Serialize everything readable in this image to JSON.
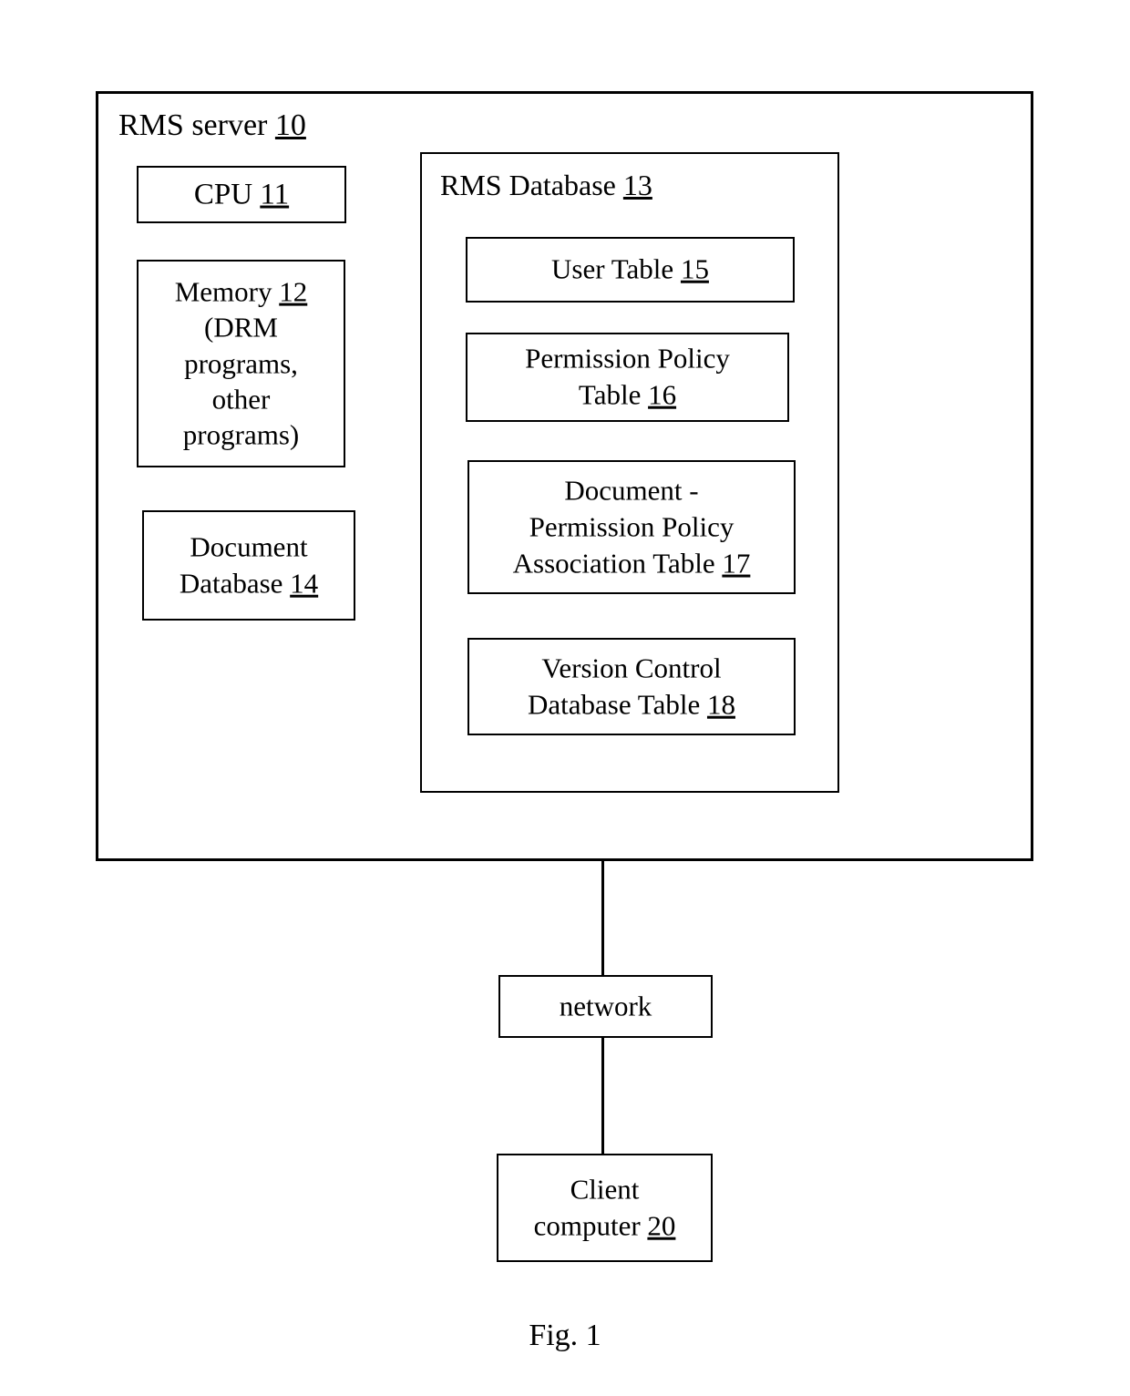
{
  "figure": {
    "caption": "Fig. 1"
  },
  "server": {
    "title_text": "RMS server ",
    "title_ref": "10",
    "cpu": {
      "text": "CPU ",
      "ref": "11"
    },
    "memory": {
      "text": "Memory ",
      "ref": "12",
      "detail": "\n(DRM\nprograms,\nother\nprograms)"
    },
    "document_database": {
      "text": "Document\nDatabase ",
      "ref": "14"
    }
  },
  "rms_database": {
    "title_text": "RMS Database ",
    "title_ref": "13",
    "tables": [
      {
        "name": "user-table",
        "text": "User Table ",
        "ref": "15"
      },
      {
        "name": "permission-policy-table",
        "text": "Permission Policy\nTable ",
        "ref": "16"
      },
      {
        "name": "document-permission-policy-association-table",
        "text": "Document -\nPermission Policy\nAssociation Table ",
        "ref": "17"
      },
      {
        "name": "version-control-database-table",
        "text": "Version Control\nDatabase Table ",
        "ref": "18"
      }
    ]
  },
  "network": {
    "label": "network"
  },
  "client": {
    "text": "Client\ncomputer ",
    "ref": "20"
  }
}
